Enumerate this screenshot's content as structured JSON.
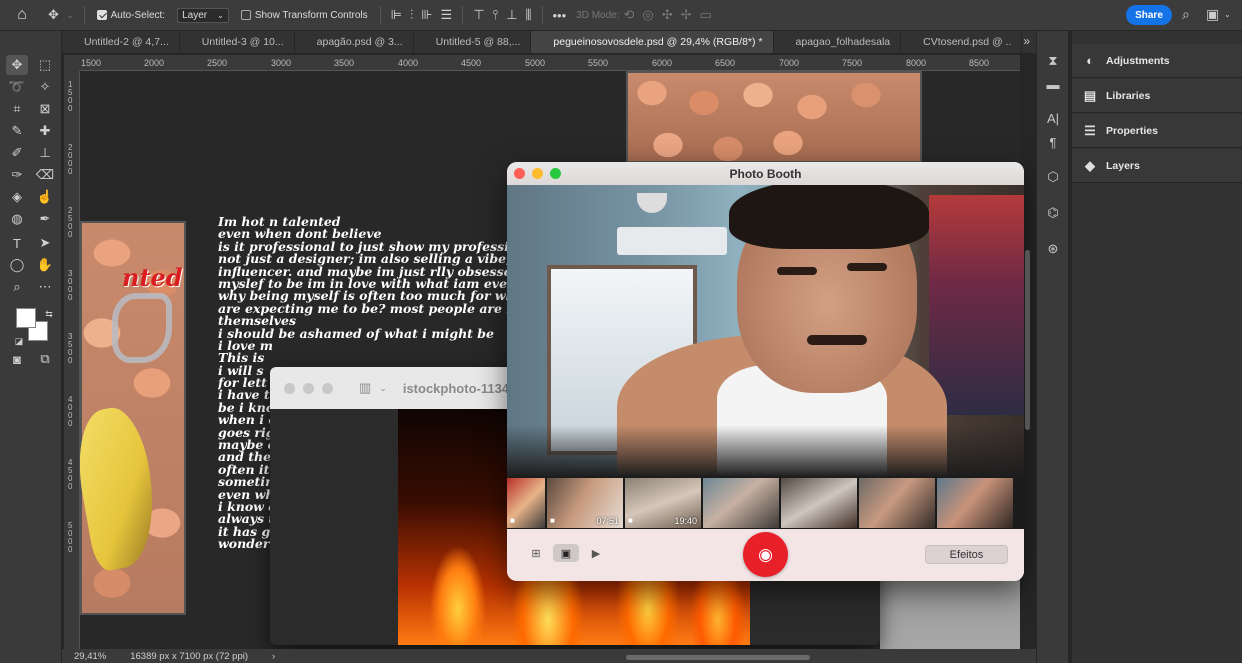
{
  "options_bar": {
    "auto_select_label": "Auto-Select:",
    "auto_select_value": "Layer",
    "show_transform_label": "Show Transform Controls",
    "mode_3d_label": "3D Mode:",
    "share_label": "Share",
    "more": "•••"
  },
  "tabs": [
    {
      "label": "Untitled-2 @ 4,7..."
    },
    {
      "label": "Untitled-3 @ 10..."
    },
    {
      "label": "apagão.psd @ 3..."
    },
    {
      "label": "Untitled-5 @ 88,..."
    },
    {
      "label": "pegueinosovosdele.psd @ 29,4% (RGB/8*) *"
    },
    {
      "label": "apagao_folhadesala"
    },
    {
      "label": "CVtosend.psd @ .."
    }
  ],
  "tabs_overflow": "»",
  "ruler_h": [
    "1500",
    "2000",
    "2500",
    "3000",
    "3500",
    "4000",
    "4500",
    "5000",
    "5500",
    "6000",
    "6500",
    "7000",
    "7500",
    "8000",
    "8500"
  ],
  "ruler_v": [
    "1500",
    "2000",
    "2500",
    "3000",
    "3500",
    "4000",
    "4500",
    "5000"
  ],
  "canvas_art": {
    "strip_text": "nted"
  },
  "poem_lines": [
    "Im hot n talented",
    "even when dont believe",
    "is it professional to just show my professi",
    "not just a designer; im also selling a vibe, i",
    "influencer. and maybe im just rlly obsesse",
    "myslef to be im in love with what iam even a",
    "why being myself is often too much for wh",
    "are expecting me to be? most people are in",
    "themselves",
    "i should be ashamed of what i might be",
    "i love m",
    "This is",
    "i will s",
    "for lett",
    "i have t",
    "be i kno",
    "when i c",
    "goes rig",
    "maybe c",
    "and the",
    "often it",
    "sometim",
    "even wh",
    "i know c",
    "always t",
    "it has g",
    "wonder"
  ],
  "preview_window": {
    "title": "istockphoto-1134"
  },
  "photo_booth": {
    "title": "Photo Booth",
    "thumb_times": [
      "",
      "07:51",
      "19:40",
      "",
      "",
      "",
      ""
    ],
    "effects_label": "Efeitos"
  },
  "panels": [
    {
      "label": "Adjustments",
      "icon": "adjustments-icon"
    },
    {
      "label": "Libraries",
      "icon": "libraries-icon"
    },
    {
      "label": "Properties",
      "icon": "properties-icon"
    },
    {
      "label": "Layers",
      "icon": "layers-icon"
    }
  ],
  "status": {
    "zoom": "29,41%",
    "doc_size": "16389 px x 7100 px (72 ppi)",
    "arrow": "›"
  },
  "colors": {
    "accent": "#1473e6",
    "shutter": "#e8202a"
  }
}
